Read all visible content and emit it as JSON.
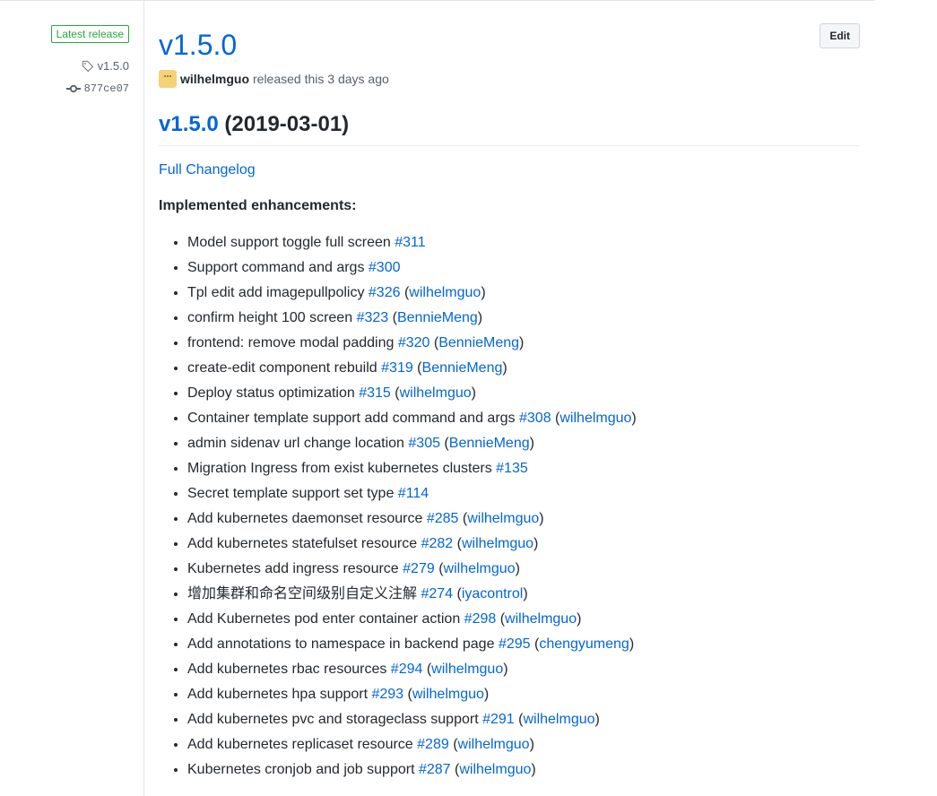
{
  "sidebar": {
    "badge": "Latest release",
    "tag": "v1.5.0",
    "commit": "877ce07"
  },
  "release": {
    "title": "v1.5.0",
    "edit_label": "Edit",
    "author": "wilhelmguo",
    "released_text": "released this 3 days ago",
    "heading_version": "v1.5.0",
    "heading_date": "(2019-03-01)",
    "changelog_link": "Full Changelog",
    "section_title": "Implemented enhancements:"
  },
  "items": [
    {
      "text": "Model support toggle full screen",
      "pr": "#311",
      "user": ""
    },
    {
      "text": "Support command and args",
      "pr": "#300",
      "user": ""
    },
    {
      "text": "Tpl edit add imagepullpolicy",
      "pr": "#326",
      "user": "wilhelmguo"
    },
    {
      "text": "confirm height 100 screen",
      "pr": "#323",
      "user": "BennieMeng"
    },
    {
      "text": "frontend: remove modal padding",
      "pr": "#320",
      "user": "BennieMeng"
    },
    {
      "text": "create-edit component rebuild",
      "pr": "#319",
      "user": "BennieMeng"
    },
    {
      "text": "Deploy status optimization",
      "pr": "#315",
      "user": "wilhelmguo"
    },
    {
      "text": "Container template support add command and args",
      "pr": "#308",
      "user": "wilhelmguo"
    },
    {
      "text": "admin sidenav url change location",
      "pr": "#305",
      "user": "BennieMeng"
    },
    {
      "text": "Migration Ingress from exist kubernetes clusters",
      "pr": "#135",
      "user": ""
    },
    {
      "text": "Secret template support set type",
      "pr": "#114",
      "user": ""
    },
    {
      "text": "Add kubernetes daemonset resource",
      "pr": "#285",
      "user": "wilhelmguo"
    },
    {
      "text": "Add kubernetes statefulset resource",
      "pr": "#282",
      "user": "wilhelmguo"
    },
    {
      "text": "Kubernetes add ingress resource",
      "pr": "#279",
      "user": "wilhelmguo"
    },
    {
      "text": "增加集群和命名空间级别自定义注解",
      "pr": "#274",
      "user": "iyacontrol"
    },
    {
      "text": "Add Kubernetes pod enter container action",
      "pr": "#298",
      "user": "wilhelmguo"
    },
    {
      "text": "Add annotations to namespace in backend page",
      "pr": "#295",
      "user": "chengyumeng"
    },
    {
      "text": "Add kubernetes rbac resources",
      "pr": "#294",
      "user": "wilhelmguo"
    },
    {
      "text": "Add kubernetes hpa support",
      "pr": "#293",
      "user": "wilhelmguo"
    },
    {
      "text": "Add kubernetes pvc and storageclass support",
      "pr": "#291",
      "user": "wilhelmguo"
    },
    {
      "text": "Add kubernetes replicaset resource",
      "pr": "#289",
      "user": "wilhelmguo"
    },
    {
      "text": "Kubernetes cronjob and job support",
      "pr": "#287",
      "user": "wilhelmguo"
    }
  ]
}
